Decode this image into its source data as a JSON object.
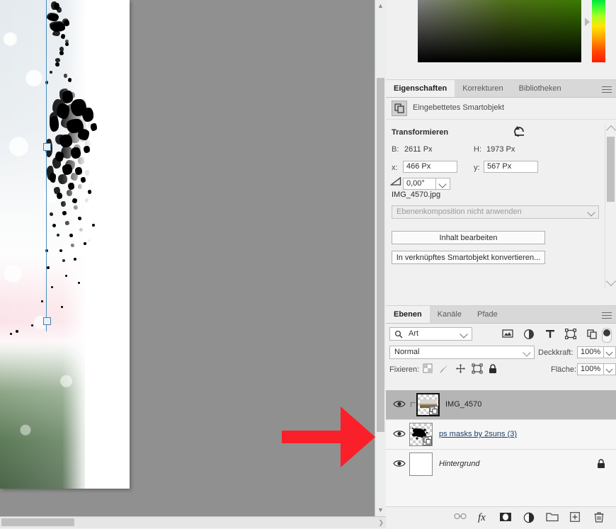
{
  "app": {
    "name": "Adobe Photoshop",
    "locale": "de-DE"
  },
  "colors": {
    "workspace_gray": "#909090",
    "panel_bg": "#f0f0f0",
    "tab_bar": "#d8d8d8",
    "selected_layer": "#b5b5b5",
    "annotation_red": "#fa2029",
    "transform_box_blue": "#4a8fc0",
    "link_text": "#1b3f66",
    "picker_hue": "#3c7a00"
  },
  "color_picker": {
    "name": "foreground-color-picker",
    "hue_marker_label": "hue-slider-marker",
    "square_label": "saturation-brightness-square"
  },
  "canvas": {
    "document_label": "document-canvas",
    "vertical_scrollbar": "canvas-vertical-scrollbar",
    "horizontal_scrollbar": "canvas-horizontal-scrollbar",
    "transform_box_label": "transform-bounding-box",
    "annotation_label": "red-arrow-annotation"
  },
  "properties_panel": {
    "tabs": [
      {
        "label": "Eigenschaften",
        "active": true
      },
      {
        "label": "Korrekturen",
        "active": false
      },
      {
        "label": "Bibliotheken",
        "active": false
      }
    ],
    "object_type": "Eingebettetes Smartobjekt",
    "section_title": "Transformieren",
    "reset_tooltip": "reset-transform-icon",
    "width_label": "B:",
    "width_value": "2611 Px",
    "height_label": "H:",
    "height_value": "1973 Px",
    "x_label": "x:",
    "x_value": "466 Px",
    "y_label": "y:",
    "y_value": "567 Px",
    "angle_value": "0,00°",
    "file_name": "IMG_4570.jpg",
    "layer_comp_placeholder": "Ebenenkomposition nicht anwenden",
    "edit_content_button": "Inhalt bearbeiten",
    "convert_button": "In verknüpftes Smartobjekt konvertieren..."
  },
  "layers_panel": {
    "tabs": [
      {
        "label": "Ebenen",
        "active": true
      },
      {
        "label": "Kanäle",
        "active": false
      },
      {
        "label": "Pfade",
        "active": false
      }
    ],
    "filter_type": "Art",
    "filter_icons": [
      "pixel-layer-filter-icon",
      "adjustment-layer-filter-icon",
      "type-layer-filter-icon",
      "shape-layer-filter-icon",
      "smart-object-filter-icon"
    ],
    "filter_toggle": "filter-enable-toggle",
    "blend_mode": "Normal",
    "opacity_label": "Deckkraft:",
    "opacity_value": "100%",
    "lock_label": "Fixieren:",
    "lock_icons": [
      "lock-transparency-icon",
      "lock-image-pixels-icon",
      "lock-position-icon",
      "lock-artboard-nesting-icon",
      "lock-all-icon"
    ],
    "fill_label": "Fläche:",
    "fill_value": "100%",
    "layers": [
      {
        "name": "IMG_4570",
        "selected": true,
        "visible": true,
        "clipped": true,
        "smart_object": true,
        "locked": false,
        "thumb_kind": "photo",
        "style": "normal"
      },
      {
        "name": "ps masks by 2suns (3)",
        "selected": false,
        "visible": true,
        "clipped": false,
        "smart_object": true,
        "locked": false,
        "thumb_kind": "splatter",
        "style": "underline-link"
      },
      {
        "name": "Hintergrund",
        "selected": false,
        "visible": true,
        "clipped": false,
        "smart_object": false,
        "locked": true,
        "thumb_kind": "white",
        "style": "italic"
      }
    ],
    "footer_icons": [
      "link-layers-icon",
      "layer-style-fx-icon",
      "add-layer-mask-icon",
      "new-adjustment-layer-icon",
      "new-group-icon",
      "new-layer-icon",
      "delete-layer-icon"
    ]
  }
}
